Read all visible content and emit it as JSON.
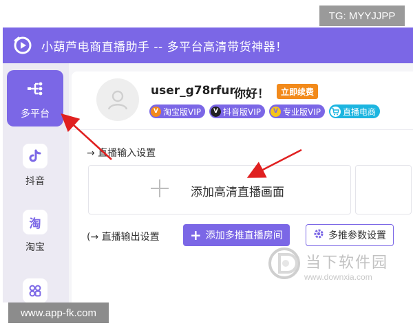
{
  "overlay": {
    "tg_tag": "TG: MYYJJPP",
    "site_tag": "www.app-fk.com"
  },
  "app": {
    "title": "小葫芦电商直播助手 -- 多平台高清带货神器！"
  },
  "sidebar": {
    "items": [
      {
        "label": "多平台",
        "icon": "multi-platform-icon",
        "active": true
      },
      {
        "label": "抖音",
        "icon": "douyin-icon",
        "active": false
      },
      {
        "label": "淘宝",
        "icon": "taobao-icon",
        "active": false
      },
      {
        "label": "",
        "icon": "apps-icon",
        "active": false
      }
    ]
  },
  "user": {
    "username": "user_g78rfur",
    "greeting": "你好！",
    "renew_button": "立即续费",
    "vip_badges": [
      {
        "label": "淘宝版VIP",
        "glyph": "V",
        "color": "#7b67e6"
      },
      {
        "label": "抖音版VIP",
        "glyph": "V",
        "color": "#7b67e6"
      },
      {
        "label": "专业版VIP",
        "glyph": "V",
        "color": "#7b67e6"
      },
      {
        "label": "直播电商",
        "glyph": "cart",
        "color": "#1cb5e0"
      }
    ]
  },
  "live_input": {
    "section_label": "→ 直播输入设置",
    "add_card_label": "添加高清直播画面"
  },
  "live_output": {
    "section_label": "(→ 直播输出设置",
    "add_room_button": "添加多推直播房间",
    "settings_button": "多推参数设置"
  },
  "watermark": {
    "name": "当下软件园",
    "url": "www.downxia.com"
  },
  "colors": {
    "accent": "#7b67e6",
    "orange": "#f28a1b",
    "cyan": "#1cb5e0",
    "annotation_red": "#e02020"
  }
}
